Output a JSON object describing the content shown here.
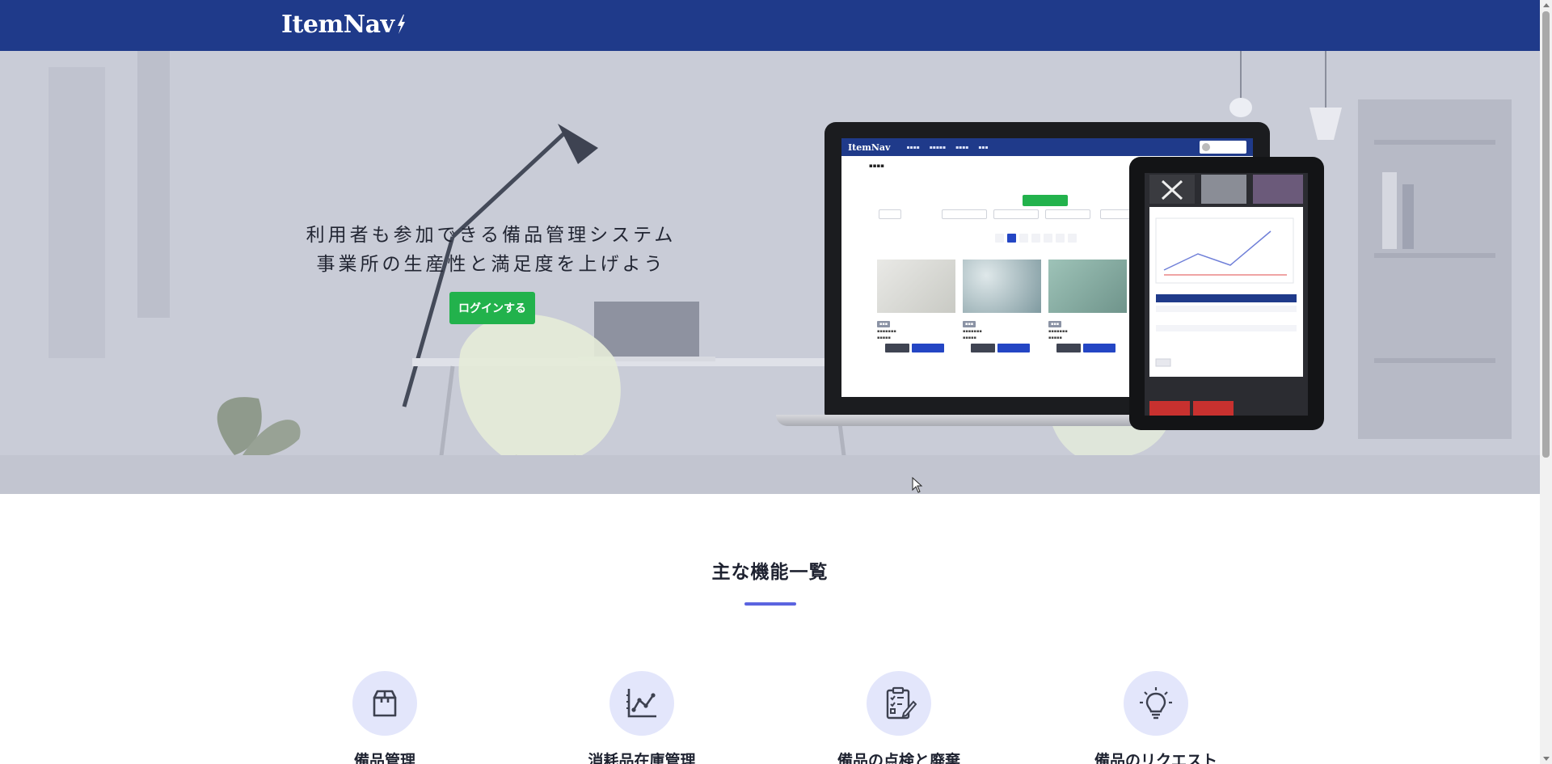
{
  "header": {
    "logo_text": "ItemNav",
    "background_color": "#1f3a8a"
  },
  "hero": {
    "headline_line1": "利用者も参加できる備品管理システム",
    "headline_line2": "事業所の生産性と満足度を上げよう",
    "login_button_label": "ログインする",
    "login_button_color": "#22b24c"
  },
  "features": {
    "title": "主な機能一覧",
    "accent_color": "#5b64e0",
    "items": [
      {
        "label": "備品管理",
        "icon": "box-icon"
      },
      {
        "label": "消耗品在庫管理",
        "icon": "line-chart-icon"
      },
      {
        "label": "備品の点検と廃棄",
        "icon": "clipboard-checklist-icon"
      },
      {
        "label": "備品のリクエスト",
        "icon": "lightbulb-icon"
      }
    ]
  }
}
